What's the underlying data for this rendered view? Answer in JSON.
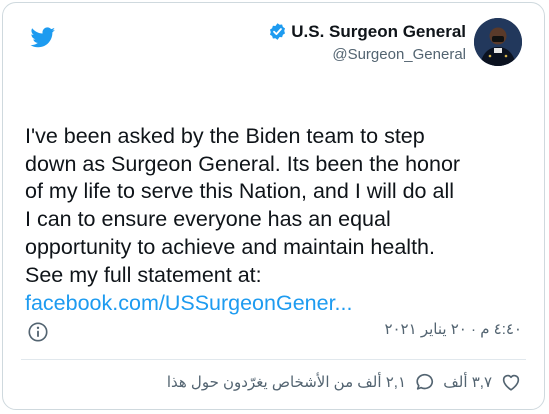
{
  "author": {
    "display_name": "U.S. Surgeon General",
    "handle": "@Surgeon_General"
  },
  "tweet": {
    "text": "I've been asked by the Biden team to step\ndown as Surgeon General.  Its been the honor\nof my life to serve this Nation, and I will do all\nI can to ensure everyone has an equal\nopportunity to achieve and maintain health.\nSee my full statement at:",
    "link": "facebook.com/USSurgeonGener..."
  },
  "timestamp": "٤:٤٠ م · ٢٠ يناير ٢٠٢١",
  "actions": {
    "like_count": "٣,٧ ألف",
    "comment_text": "٢,١ ألف من الأشخاص يغرّدون حول هذا"
  },
  "colors": {
    "brand_blue": "#1d9bf0",
    "text": "#0f1419",
    "secondary": "#536471"
  },
  "icons": [
    "twitter-bird-icon",
    "verified-badge-icon",
    "info-icon",
    "heart-icon",
    "comment-icon"
  ]
}
